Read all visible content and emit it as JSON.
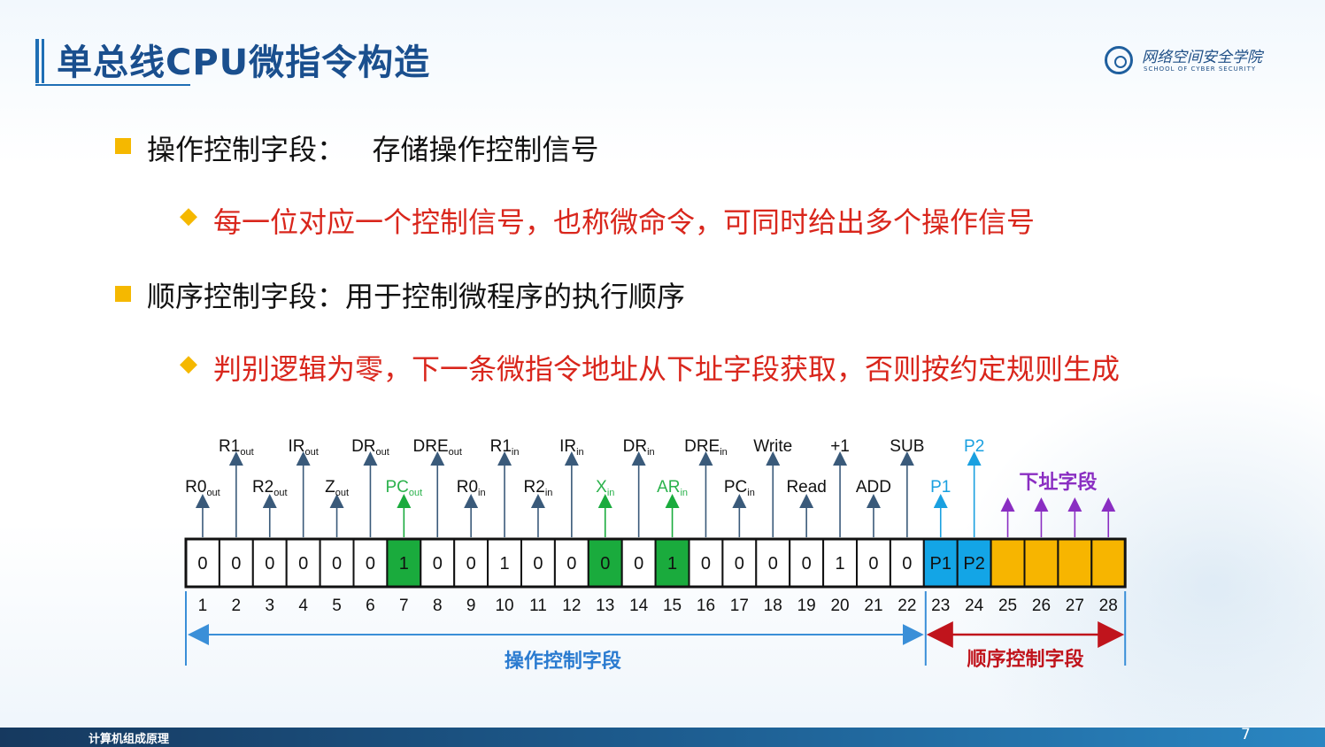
{
  "slide": {
    "title": "单总线CPU微指令构造",
    "logo": {
      "cn": "网络空间安全学院",
      "en": "SCHOOL OF CYBER SECURITY"
    },
    "footer": "计算机组成原理",
    "page": "7"
  },
  "bullets": [
    {
      "text": "操作控制字段：   存储操作控制信号",
      "sub": "每一位对应一个控制信号，也称微命令，可同时给出多个操作信号"
    },
    {
      "text": "顺序控制字段：用于控制微程序的执行顺序",
      "sub": "判别逻辑为零，下一条微指令地址从下址字段获取，否则按约定规则生成"
    }
  ],
  "diagram": {
    "bits": [
      "0",
      "0",
      "0",
      "0",
      "0",
      "0",
      "1",
      "0",
      "0",
      "1",
      "0",
      "0",
      "0",
      "0",
      "1",
      "0",
      "0",
      "0",
      "0",
      "1",
      "0",
      "0",
      "P1",
      "P2",
      "",
      "",
      "",
      ""
    ],
    "bit_colors": [
      "none",
      "none",
      "none",
      "none",
      "none",
      "none",
      "green",
      "none",
      "none",
      "none",
      "none",
      "none",
      "green",
      "none",
      "green",
      "none",
      "none",
      "none",
      "none",
      "none",
      "none",
      "none",
      "blue",
      "blue",
      "yellow",
      "yellow",
      "yellow",
      "yellow"
    ],
    "bit_numbers": [
      "1",
      "2",
      "3",
      "4",
      "5",
      "6",
      "7",
      "8",
      "9",
      "10",
      "11",
      "12",
      "13",
      "14",
      "15",
      "16",
      "17",
      "18",
      "19",
      "20",
      "21",
      "22",
      "23",
      "24",
      "25",
      "26",
      "27",
      "28"
    ],
    "signals": [
      {
        "bit": 1,
        "base": "R0",
        "sub": "out",
        "row": "low",
        "color": "#111111"
      },
      {
        "bit": 2,
        "base": "R1",
        "sub": "out",
        "row": "high",
        "color": "#111111"
      },
      {
        "bit": 3,
        "base": "R2",
        "sub": "out",
        "row": "low",
        "color": "#111111"
      },
      {
        "bit": 4,
        "base": "IR",
        "sub": "out",
        "row": "high",
        "color": "#111111"
      },
      {
        "bit": 5,
        "base": "Z",
        "sub": "out",
        "row": "low",
        "color": "#111111"
      },
      {
        "bit": 6,
        "base": "DR",
        "sub": "out",
        "row": "high",
        "color": "#111111"
      },
      {
        "bit": 7,
        "base": "PC",
        "sub": "out",
        "row": "low",
        "color": "#2bb24c"
      },
      {
        "bit": 8,
        "base": "DRE",
        "sub": "out",
        "row": "high",
        "color": "#111111"
      },
      {
        "bit": 9,
        "base": "R0",
        "sub": "in",
        "row": "low",
        "color": "#111111"
      },
      {
        "bit": 10,
        "base": "R1",
        "sub": "in",
        "row": "high",
        "color": "#111111"
      },
      {
        "bit": 11,
        "base": "R2",
        "sub": "in",
        "row": "low",
        "color": "#111111"
      },
      {
        "bit": 12,
        "base": "IR",
        "sub": "in",
        "row": "high",
        "color": "#111111"
      },
      {
        "bit": 13,
        "base": "X",
        "sub": "in",
        "row": "low",
        "color": "#2bb24c"
      },
      {
        "bit": 14,
        "base": "DR",
        "sub": "in",
        "row": "high",
        "color": "#111111"
      },
      {
        "bit": 15,
        "base": "AR",
        "sub": "in",
        "row": "low",
        "color": "#2bb24c"
      },
      {
        "bit": 16,
        "base": "DRE",
        "sub": "in",
        "row": "high",
        "color": "#111111"
      },
      {
        "bit": 17,
        "base": "PC",
        "sub": "in",
        "row": "low",
        "color": "#111111"
      },
      {
        "bit": 18,
        "base": "Write",
        "sub": "",
        "row": "high",
        "color": "#111111"
      },
      {
        "bit": 19,
        "base": "Read",
        "sub": "",
        "row": "low",
        "color": "#111111"
      },
      {
        "bit": 20,
        "base": "+1",
        "sub": "",
        "row": "high",
        "color": "#111111"
      },
      {
        "bit": 21,
        "base": "ADD",
        "sub": "",
        "row": "low",
        "color": "#111111"
      },
      {
        "bit": 22,
        "base": "SUB",
        "sub": "",
        "row": "high",
        "color": "#111111"
      },
      {
        "bit": 23,
        "base": "P1",
        "sub": "",
        "row": "low",
        "color": "#1aa0e0"
      },
      {
        "bit": 24,
        "base": "P2",
        "sub": "",
        "row": "high",
        "color": "#1aa0e0"
      }
    ],
    "next_addr_label": "下址字段",
    "op_field_label": "操作控制字段",
    "seq_field_label": "顺序控制字段",
    "colors": {
      "green": "#1aab3d",
      "blue": "#13a5e6",
      "yellow": "#f7b500",
      "arrow": "#3a5a7a",
      "purple": "#8a2ec2",
      "dim_blue": "#3a8fd8",
      "dim_red": "#c0141c",
      "op_label": "#2a7bd0",
      "seq_label": "#c0141c",
      "next_label": "#8a2ec2"
    }
  }
}
